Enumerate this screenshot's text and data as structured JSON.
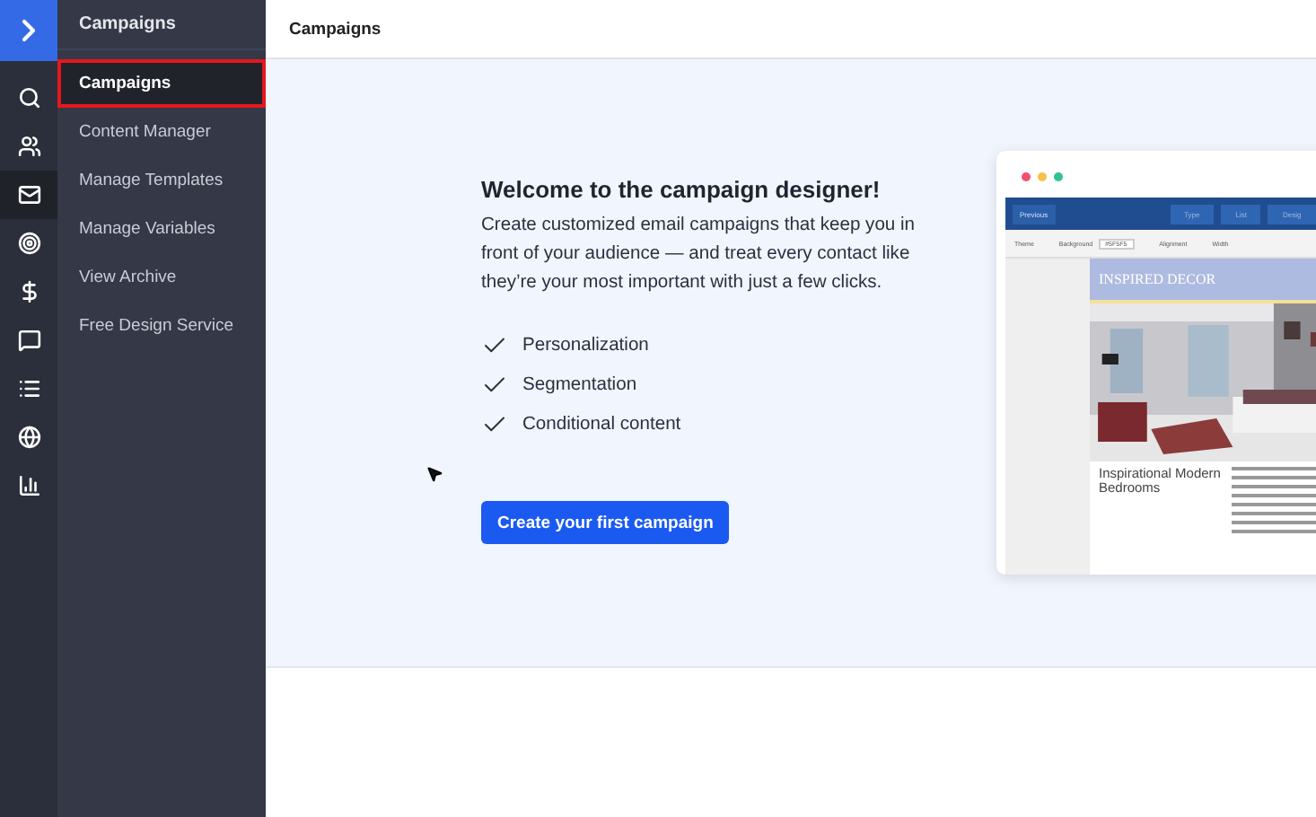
{
  "rail": {
    "items": [
      {
        "selected": false
      },
      {
        "selected": false
      },
      {
        "selected": true
      },
      {
        "selected": false
      },
      {
        "selected": false
      },
      {
        "selected": false
      },
      {
        "selected": false
      },
      {
        "selected": false
      },
      {
        "selected": false
      }
    ]
  },
  "sidebar": {
    "title": "Campaigns",
    "items": [
      {
        "label": "Campaigns",
        "selected": true,
        "highlighted": true
      },
      {
        "label": "Content Manager",
        "selected": false,
        "highlighted": false
      },
      {
        "label": "Manage Templates",
        "selected": false,
        "highlighted": false
      },
      {
        "label": "Manage Variables",
        "selected": false,
        "highlighted": false
      },
      {
        "label": "View Archive",
        "selected": false,
        "highlighted": false
      },
      {
        "label": "Free Design Service",
        "selected": false,
        "highlighted": false
      }
    ]
  },
  "header": {
    "title": "Campaigns"
  },
  "welcome": {
    "heading": "Welcome to the campaign designer!",
    "text": "Create customized email campaigns that keep you in front of your audience — and treat every contact like they’re your most important with just a few clicks.",
    "features": [
      "Personalization",
      "Segmentation",
      "Conditional content"
    ],
    "button": "Create your first campaign"
  },
  "preview": {
    "back": "Previous",
    "steps": [
      "Type",
      "List",
      "Desig"
    ],
    "toolbar": [
      "Theme",
      "Background",
      "Alignment",
      "Width"
    ],
    "background_value": "#5F5F5",
    "banner": "INSPIRED DECOR",
    "article_title": "Inspirational Modern Bedrooms",
    "photo": {
      "kind": "picture"
    }
  }
}
